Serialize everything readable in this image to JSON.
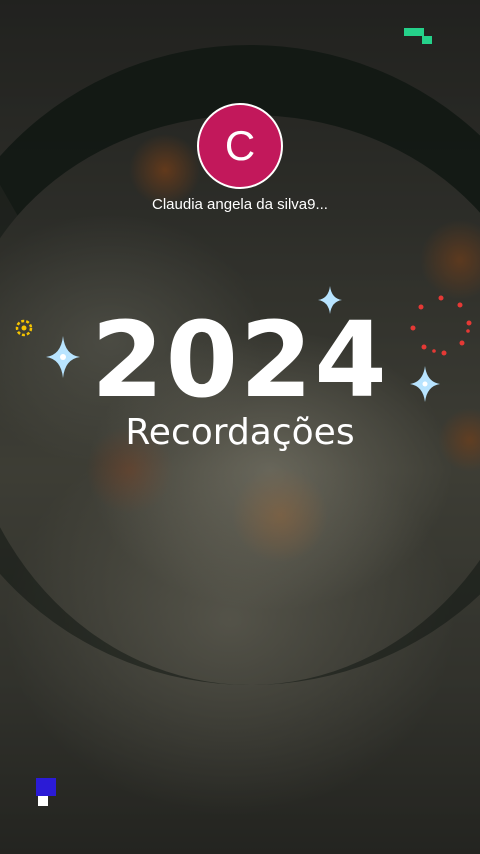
{
  "story": {
    "username": "Claudia angela da silva9...",
    "avatar_initial": "C",
    "year": "2024",
    "subtitle": "Recordações"
  },
  "colors": {
    "avatar_bg": "#c2185b",
    "text": "#ffffff",
    "sparkle": "#b8e4ff",
    "accent_yellow": "#f5c400",
    "accent_red": "#e53935",
    "accent_green": "#25d18a",
    "accent_blue": "#2b1bd6"
  },
  "icons": [
    "sparkle-icon",
    "ring-icon",
    "dots-circle-icon",
    "pixel-deco-icon"
  ]
}
